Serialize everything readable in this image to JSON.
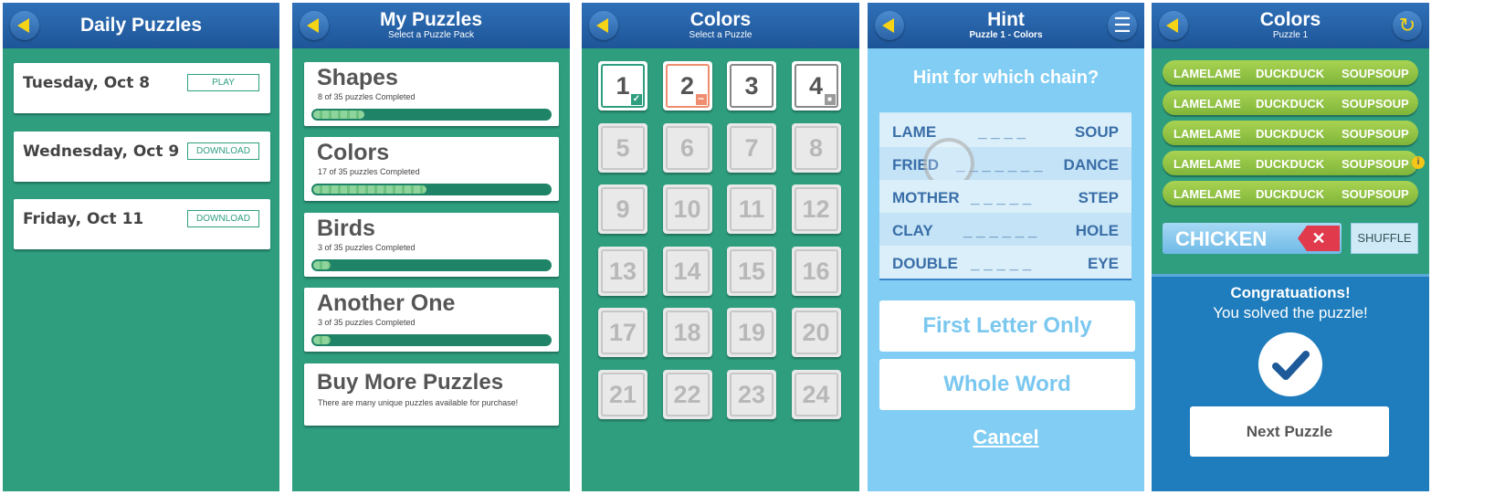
{
  "daily": {
    "title": "Daily Puzzles",
    "items": [
      {
        "date": "Tuesday, Oct 8",
        "action": "PLAY"
      },
      {
        "date": "Wednesday, Oct 9",
        "action": "DOWNLOAD"
      },
      {
        "date": "Friday, Oct 11",
        "action": "DOWNLOAD"
      }
    ]
  },
  "mypuzzles": {
    "title": "My Puzzles",
    "subtitle": "Select a Puzzle Pack",
    "packs": [
      {
        "name": "Shapes",
        "progress_text": "8 of 35 puzzles Completed",
        "progress": 0.229
      },
      {
        "name": "Colors",
        "progress_text": "17 of 35 puzzles Completed",
        "progress": 0.486
      },
      {
        "name": "Birds",
        "progress_text": "3 of 35 puzzles Completed",
        "progress": 0.086
      },
      {
        "name": "Another One",
        "progress_text": "3 of 35 puzzles Completed",
        "progress": 0.086
      }
    ],
    "buy": {
      "title": "Buy More Puzzles",
      "subtitle": "There are many unique puzzles available for purchase!"
    }
  },
  "colors_select": {
    "title": "Colors",
    "subtitle": "Select a Puzzle",
    "puzzles": [
      "1",
      "2",
      "3",
      "4",
      "5",
      "6",
      "7",
      "8",
      "9",
      "10",
      "11",
      "12",
      "13",
      "14",
      "15",
      "16",
      "17",
      "18",
      "19",
      "20",
      "21",
      "22",
      "23",
      "24"
    ]
  },
  "hint": {
    "title": "Hint",
    "subtitle": "Puzzle 1 - Colors",
    "question": "Hint for which chain?",
    "chains": [
      {
        "left": "LAME",
        "blanks": "_ _ _ _",
        "right": "SOUP"
      },
      {
        "left": "FRIED",
        "blanks": "_ _ _ _ _ _ _",
        "right": "DANCE"
      },
      {
        "left": "MOTHER",
        "blanks": "_ _ _ _ _",
        "right": "STEP"
      },
      {
        "left": "CLAY",
        "blanks": "_ _ _ _ _ _",
        "right": "HOLE"
      },
      {
        "left": "DOUBLE",
        "blanks": "_ _ _ _ _",
        "right": "EYE"
      }
    ],
    "first_letter": "First Letter Only",
    "whole_word": "Whole Word",
    "cancel": "Cancel"
  },
  "solved": {
    "title": "Colors",
    "subtitle": "Puzzle 1",
    "rows": [
      [
        "LAMELAME",
        "DUCKDUCK",
        "SOUPSOUP"
      ],
      [
        "LAMELAME",
        "DUCKDUCK",
        "SOUPSOUP"
      ],
      [
        "LAMELAME",
        "DUCKDUCK",
        "SOUPSOUP"
      ],
      [
        "LAMELAME",
        "DUCKDUCK",
        "SOUPSOUP"
      ],
      [
        "LAMELAME",
        "DUCKDUCK",
        "SOUPSOUP"
      ]
    ],
    "input": "CHICKEN",
    "shuffle": "SHUFFLE",
    "congrats_line1": "Congratuations!",
    "congrats_line2": "You solved the puzzle!",
    "next": "Next Puzzle"
  },
  "colors": {
    "teal": "#2e9e7f",
    "header_blue": "#2a63a6",
    "hint_blue": "#81cdf3",
    "accent_yellow": "#f5d417",
    "pill_green": "#96c647"
  }
}
